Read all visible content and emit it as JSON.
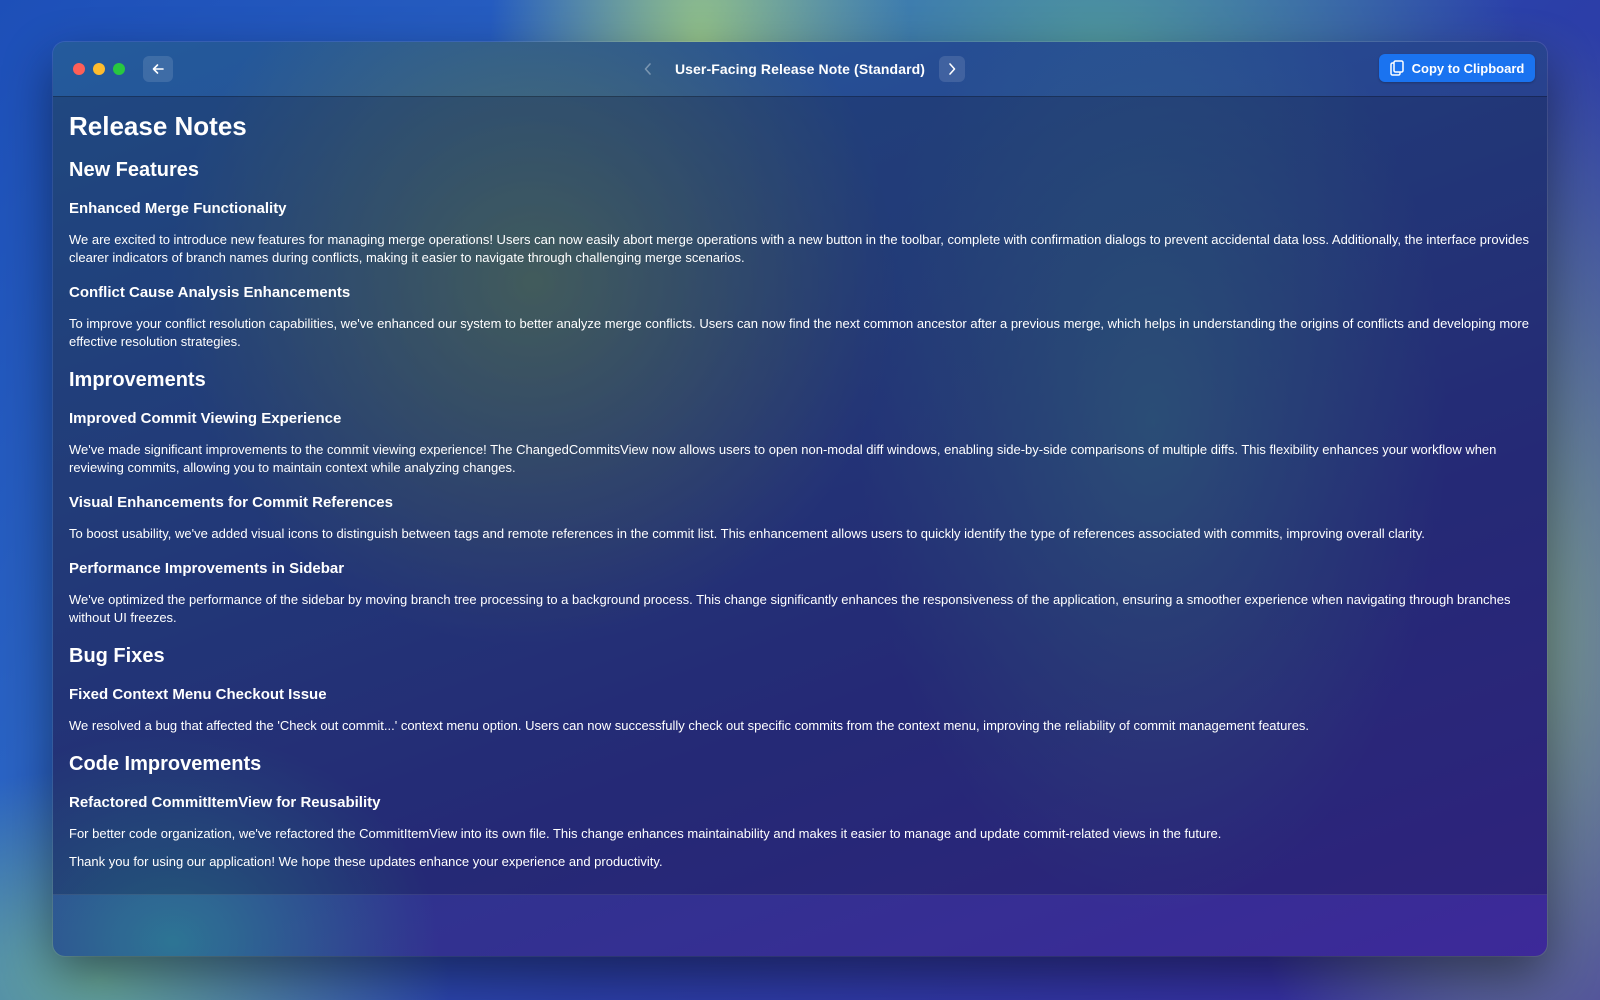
{
  "window": {
    "nav_title": "User-Facing Release Note (Standard)",
    "copy_label": "Copy to Clipboard"
  },
  "doc": {
    "title": "Release Notes",
    "sections": [
      {
        "heading": "New Features",
        "items": [
          {
            "title": "Enhanced Merge Functionality",
            "body": "We are excited to introduce new features for managing merge operations! Users can now easily abort merge operations with a new button in the toolbar, complete with confirmation dialogs to prevent accidental data loss. Additionally, the interface provides clearer indicators of branch names during conflicts, making it easier to navigate through challenging merge scenarios."
          },
          {
            "title": "Conflict Cause Analysis Enhancements",
            "body": "To improve your conflict resolution capabilities, we've enhanced our system to better analyze merge conflicts. Users can now find the next common ancestor after a previous merge, which helps in understanding the origins of conflicts and developing more effective resolution strategies."
          }
        ]
      },
      {
        "heading": "Improvements",
        "items": [
          {
            "title": "Improved Commit Viewing Experience",
            "body": "We've made significant improvements to the commit viewing experience! The ChangedCommitsView now allows users to open non-modal diff windows, enabling side-by-side comparisons of multiple diffs. This flexibility enhances your workflow when reviewing commits, allowing you to maintain context while analyzing changes."
          },
          {
            "title": "Visual Enhancements for Commit References",
            "body": "To boost usability, we've added visual icons to distinguish between tags and remote references in the commit list. This enhancement allows users to quickly identify the type of references associated with commits, improving overall clarity."
          },
          {
            "title": "Performance Improvements in Sidebar",
            "body": "We've optimized the performance of the sidebar by moving branch tree processing to a background process. This change significantly enhances the responsiveness of the application, ensuring a smoother experience when navigating through branches without UI freezes."
          }
        ]
      },
      {
        "heading": "Bug Fixes",
        "items": [
          {
            "title": "Fixed Context Menu Checkout Issue",
            "body": "We resolved a bug that affected the 'Check out commit...' context menu option. Users can now successfully check out specific commits from the context menu, improving the reliability of commit management features."
          }
        ]
      },
      {
        "heading": "Code Improvements",
        "items": [
          {
            "title": "Refactored CommitItemView for Reusability",
            "body": "For better code organization, we've refactored the CommitItemView into its own file. This change enhances maintainability and makes it easier to manage and update commit-related views in the future."
          }
        ]
      }
    ],
    "closing": "Thank you for using our application! We hope these updates enhance your experience and productivity."
  }
}
